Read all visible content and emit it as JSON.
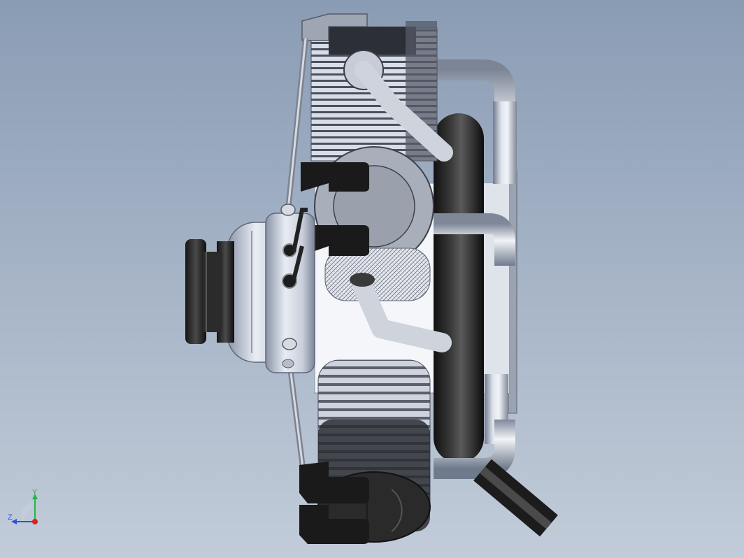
{
  "viewport": {
    "background_top": "#8a9cb4",
    "background_bottom": "#c2ccd9"
  },
  "model": {
    "icon": "radial-engine-model"
  },
  "triad": {
    "x_label": "",
    "y_label": "Y",
    "z_label": "Z",
    "y_color": "#2bb24c",
    "z_color": "#2a55d6",
    "x_color": "#e02020"
  }
}
